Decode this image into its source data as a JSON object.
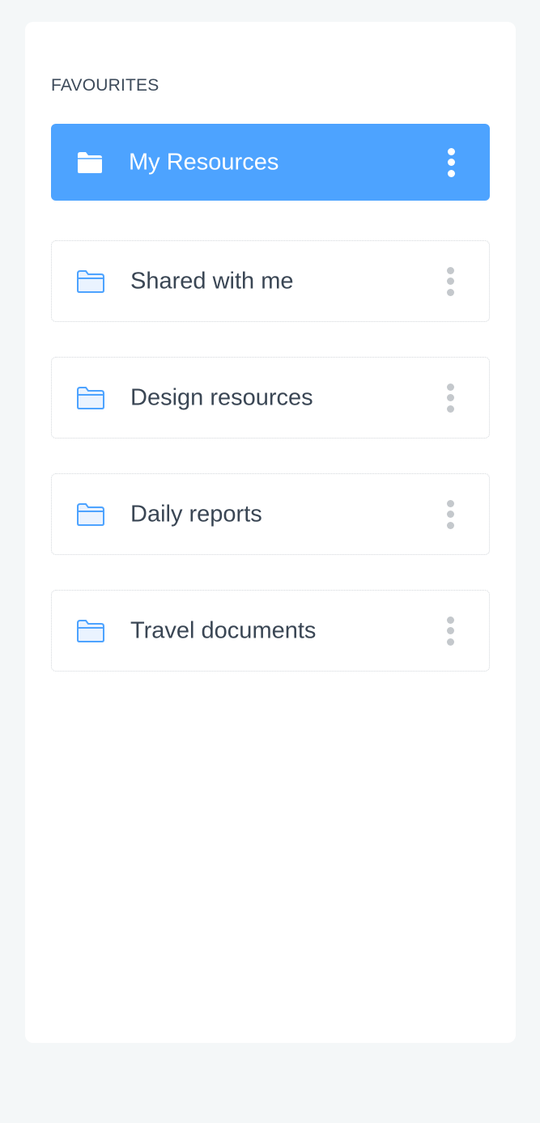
{
  "favourites": {
    "title": "FAVOURITES",
    "items": [
      {
        "label": "My Resources",
        "icon": "folder-icon",
        "active": true
      },
      {
        "label": "Shared with me",
        "icon": "folder-icon",
        "active": false
      },
      {
        "label": "Design resources",
        "icon": "folder-icon",
        "active": false
      },
      {
        "label": "Daily reports",
        "icon": "folder-icon",
        "active": false
      },
      {
        "label": "Travel documents",
        "icon": "folder-icon",
        "active": false
      }
    ]
  },
  "colors": {
    "accent": "#4da3ff",
    "background": "#f4f7f8",
    "panel": "#ffffff",
    "text": "#3a4654",
    "dots": "#c4c8cc"
  }
}
